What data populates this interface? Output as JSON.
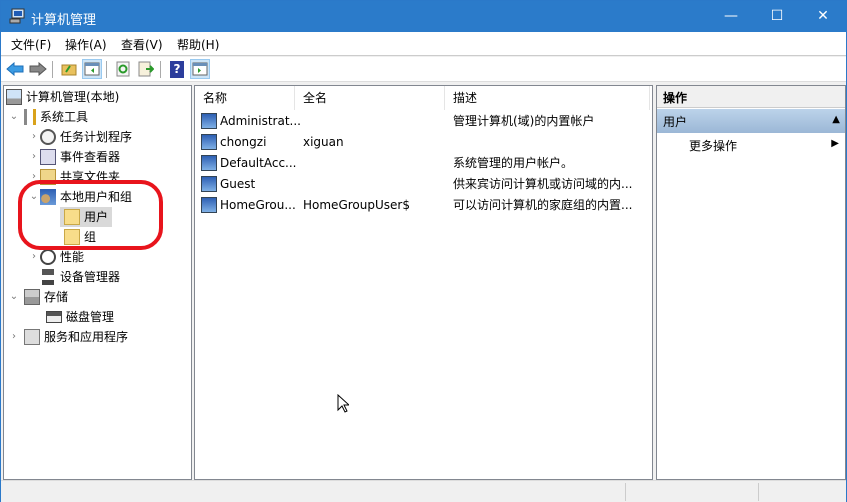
{
  "window": {
    "title": "计算机管理",
    "minimize": "—",
    "maximize": "☐",
    "close": "✕"
  },
  "menu": [
    "文件(F)",
    "操作(A)",
    "查看(V)",
    "帮助(H)"
  ],
  "toolbar": {
    "help_glyph": "?"
  },
  "tree": [
    {
      "label": "计算机管理(本地)",
      "icon": "computer-management-icon"
    },
    {
      "label": "系统工具",
      "icon": "tools-icon"
    },
    {
      "label": "任务计划程序",
      "icon": "clock-icon"
    },
    {
      "label": "事件查看器",
      "icon": "event-viewer-icon"
    },
    {
      "label": "共享文件夹",
      "icon": "shared-folder-icon"
    },
    {
      "label": "本地用户和组",
      "icon": "users-group-icon"
    },
    {
      "label": "用户",
      "icon": "folder-icon"
    },
    {
      "label": "组",
      "icon": "folder-icon"
    },
    {
      "label": "性能",
      "icon": "performance-icon"
    },
    {
      "label": "设备管理器",
      "icon": "device-manager-icon"
    },
    {
      "label": "存储",
      "icon": "storage-icon"
    },
    {
      "label": "磁盘管理",
      "icon": "disk-icon"
    },
    {
      "label": "服务和应用程序",
      "icon": "services-icon"
    }
  ],
  "table": {
    "columns": [
      "名称",
      "全名",
      "描述"
    ],
    "rows": [
      {
        "name": "Administrat...",
        "fullname": "",
        "desc": "管理计算机(域)的内置帐户"
      },
      {
        "name": "chongzi",
        "fullname": "xiguan",
        "desc": ""
      },
      {
        "name": "DefaultAcc...",
        "fullname": "",
        "desc": "系统管理的用户帐户。"
      },
      {
        "name": "Guest",
        "fullname": "",
        "desc": "供来宾访问计算机或访问域的内..."
      },
      {
        "name": "HomeGrou...",
        "fullname": "HomeGroupUser$",
        "desc": "可以访问计算机的家庭组的内置..."
      }
    ]
  },
  "actions": {
    "header": "操作",
    "section": "用户",
    "more": "更多操作",
    "collapse_glyph": "▲",
    "arrow_glyph": "▶"
  },
  "colors": {
    "titlebar": "#2b7bca",
    "highlight": "#e8141c"
  }
}
